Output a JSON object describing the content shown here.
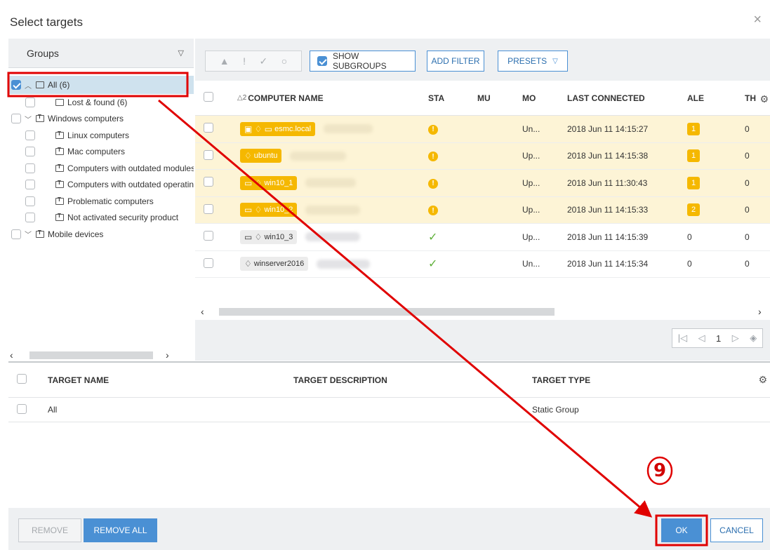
{
  "dialog": {
    "title": "Select targets",
    "close_glyph": "×"
  },
  "groups": {
    "header": "Groups",
    "tree": [
      {
        "label": "All (6)",
        "checked": true,
        "expander": "^",
        "kind": "static",
        "indent": 0,
        "selected": true
      },
      {
        "label": "Lost & found (6)",
        "checked": false,
        "expander": "",
        "kind": "static",
        "indent": 1
      },
      {
        "label": "Windows computers",
        "checked": false,
        "expander": "v",
        "kind": "dynamic",
        "indent": 0
      },
      {
        "label": "Linux computers",
        "checked": false,
        "expander": "",
        "kind": "dynamic",
        "indent": 1
      },
      {
        "label": "Mac computers",
        "checked": false,
        "expander": "",
        "kind": "dynamic",
        "indent": 1
      },
      {
        "label": "Computers with outdated modules",
        "checked": false,
        "expander": "",
        "kind": "dynamic",
        "indent": 1
      },
      {
        "label": "Computers with outdated operating system",
        "checked": false,
        "expander": "",
        "kind": "dynamic",
        "indent": 1
      },
      {
        "label": "Problematic computers",
        "checked": false,
        "expander": "",
        "kind": "dynamic",
        "indent": 1
      },
      {
        "label": "Not activated security product",
        "checked": false,
        "expander": "",
        "kind": "dynamic",
        "indent": 1
      },
      {
        "label": "Mobile devices",
        "checked": false,
        "expander": "v",
        "kind": "dynamic",
        "indent": 0
      }
    ]
  },
  "toolbar": {
    "status_icons": [
      "▲",
      "!",
      "✓",
      "○"
    ],
    "show_subgroups_label": "SHOW SUBGROUPS",
    "add_filter_label": "ADD FILTER",
    "presets_label": "PRESETS"
  },
  "computers": {
    "columns": {
      "sort_indicator": "△2",
      "name": "COMPUTER NAME",
      "status": "STA",
      "muted": "MU",
      "modules": "MO",
      "last_connected": "LAST CONNECTED",
      "alerts": "ALE",
      "threats": "TH"
    },
    "rows": [
      {
        "name": "esmc.local",
        "icons": "▣ ♢ ▭",
        "highlight": true,
        "status": "warn",
        "mo": "Un...",
        "last": "2018 Jun 11 14:15:27",
        "alerts": "1",
        "threats": "0"
      },
      {
        "name": "ubuntu",
        "icons": "♢",
        "highlight": true,
        "status": "warn",
        "mo": "Up...",
        "last": "2018 Jun 11 14:15:38",
        "alerts": "1",
        "threats": "0"
      },
      {
        "name": "win10_1",
        "icons": "▭ ♢",
        "highlight": true,
        "status": "warn",
        "mo": "Up...",
        "last": "2018 Jun 11 11:30:43",
        "alerts": "1",
        "threats": "0"
      },
      {
        "name": "win10_2",
        "icons": "▭ ♢",
        "highlight": true,
        "status": "warn",
        "mo": "Up...",
        "last": "2018 Jun 11 14:15:33",
        "alerts": "2",
        "threats": "0"
      },
      {
        "name": "win10_3",
        "icons": "▭ ♢",
        "highlight": false,
        "status": "ok",
        "mo": "Up...",
        "last": "2018 Jun 11 14:15:39",
        "alerts": "0",
        "threats": "0"
      },
      {
        "name": "winserver2016",
        "icons": "♢",
        "highlight": false,
        "status": "ok",
        "mo": "Un...",
        "last": "2018 Jun 11 14:15:34",
        "alerts": "0",
        "threats": "0"
      }
    ]
  },
  "pager": {
    "page": "1"
  },
  "targets": {
    "columns": {
      "name": "TARGET NAME",
      "description": "TARGET DESCRIPTION",
      "type": "TARGET TYPE"
    },
    "rows": [
      {
        "name": "All",
        "description": "",
        "type": "Static Group"
      }
    ]
  },
  "footer": {
    "remove_label": "REMOVE",
    "remove_all_label": "REMOVE ALL",
    "ok_label": "OK",
    "cancel_label": "CANCEL"
  },
  "annotation": {
    "step_label": "9",
    "color": "#e00000"
  },
  "colors": {
    "accent": "#4a90d4",
    "warning": "#f5b800",
    "ok": "#5fb03a",
    "selected_row": "#cfe2ee"
  }
}
